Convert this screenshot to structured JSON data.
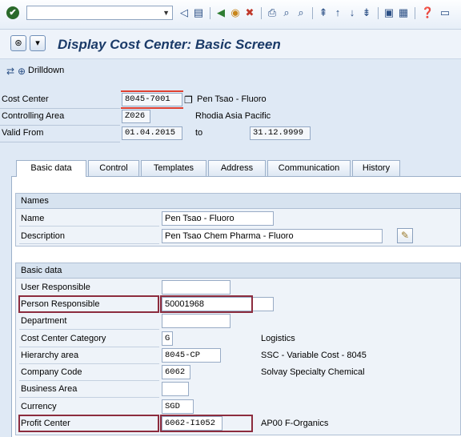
{
  "toolbar": {
    "enter_icon": "checkmark-icon",
    "command_field": "",
    "icons": [
      "dropdown-icon",
      "back-arrow-icon",
      "save-icon",
      "back-icon",
      "exit-icon",
      "cancel-icon",
      "print-icon",
      "find-icon",
      "find-next-icon",
      "first-page-icon",
      "previous-page-icon",
      "next-page-icon",
      "last-page-icon",
      "new-session-icon",
      "shortcut-icon",
      "help-icon"
    ]
  },
  "title": {
    "text": "Display Cost Center: Basic Screen"
  },
  "app_toolbar": {
    "drilldown_label": "Drilldown"
  },
  "header": {
    "cost_center_label": "Cost Center",
    "cost_center_value": "8045-7001",
    "cost_center_desc": "Pen Tsao - Fluoro",
    "controlling_area_label": "Controlling Area",
    "controlling_area_value": "Z026",
    "controlling_area_desc": "Rhodia Asia Pacific",
    "valid_from_label": "Valid From",
    "valid_from_value": "01.04.2015",
    "to_label": "to",
    "valid_to_value": "31.12.9999"
  },
  "tabs": [
    "Basic data",
    "Control",
    "Templates",
    "Address",
    "Communication",
    "History"
  ],
  "names_group": {
    "title": "Names",
    "name_label": "Name",
    "name_value": "Pen Tsao - Fluoro",
    "description_label": "Description",
    "description_value": "Pen Tsao Chem Pharma - Fluoro"
  },
  "basic_group": {
    "title": "Basic data",
    "rows": [
      {
        "label": "User Responsible",
        "value": "",
        "desc": ""
      },
      {
        "label": "Person Responsible",
        "value": "50001968",
        "desc": ""
      },
      {
        "label": "Department",
        "value": "",
        "desc": ""
      },
      {
        "label": "Cost Center Category",
        "value": "G",
        "desc": "Logistics"
      },
      {
        "label": "Hierarchy area",
        "value": "8045-CP",
        "desc": "SSC - Variable Cost - 8045"
      },
      {
        "label": "Company Code",
        "value": "6062",
        "desc": "Solvay Specialty Chemical"
      },
      {
        "label": "Business Area",
        "value": "",
        "desc": ""
      },
      {
        "label": "Currency",
        "value": "SGD",
        "desc": ""
      },
      {
        "label": "Profit Center",
        "value": "6062-I1052",
        "desc": "AP00 F-Organics"
      }
    ]
  },
  "colors": {
    "background": "#dfe9f5",
    "highlight_border": "#8c2c3e",
    "title_text": "#1a3a68"
  }
}
